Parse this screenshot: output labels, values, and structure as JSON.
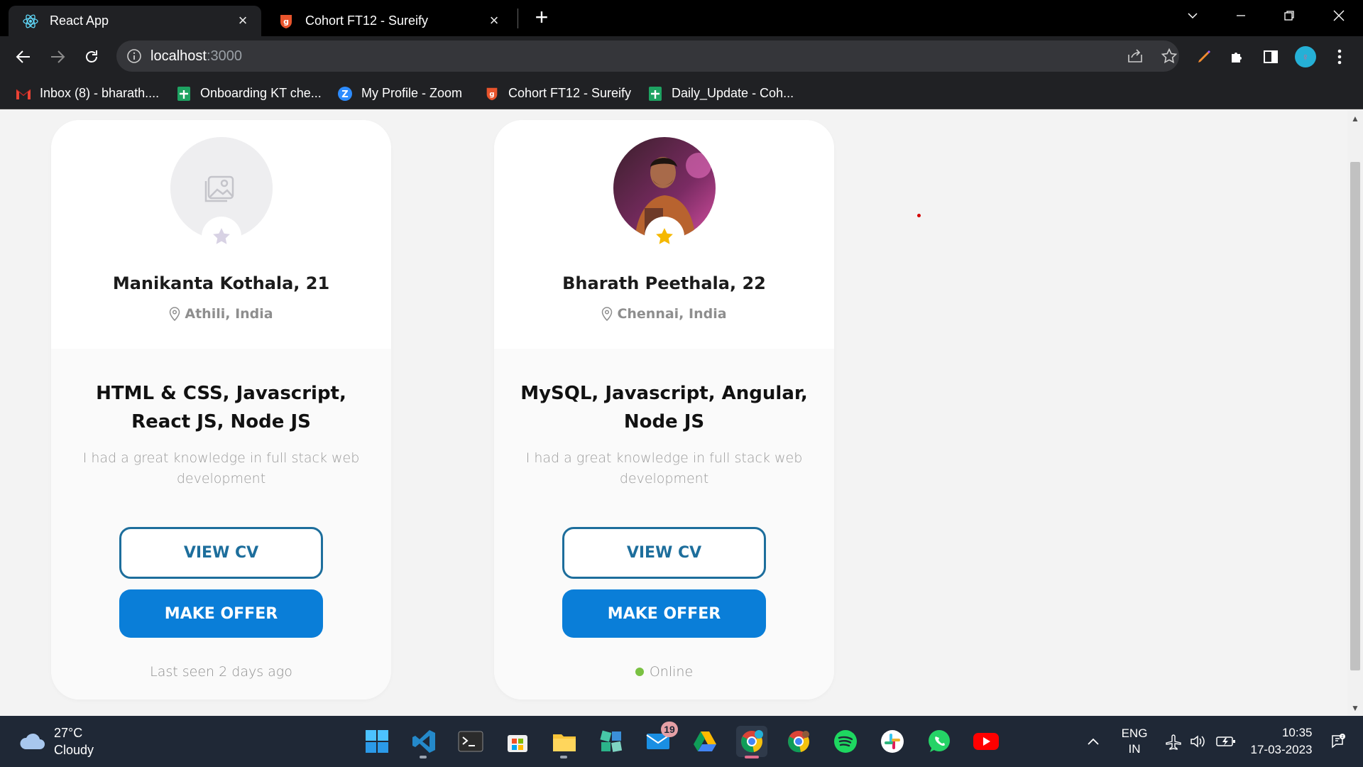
{
  "browser": {
    "tabs": [
      {
        "title": "React App",
        "icon": "react-icon",
        "active": true
      },
      {
        "title": "Cohort FT12 - Sureify",
        "icon": "sureify-icon",
        "active": false
      }
    ],
    "new_tab_label": "+",
    "url_host": "localhost",
    "url_port": ":3000",
    "bookmarks": [
      {
        "label": "Inbox (8) - bharath....",
        "icon": "gmail-icon"
      },
      {
        "label": "Onboarding KT che...",
        "icon": "google-sheets-icon"
      },
      {
        "label": "My Profile - Zoom",
        "icon": "zoom-icon"
      },
      {
        "label": "Cohort FT12 - Sureify",
        "icon": "sureify-icon"
      },
      {
        "label": "Daily_Update - Coh...",
        "icon": "google-sheets-icon"
      }
    ]
  },
  "cards": [
    {
      "name": "Manikanta Kothala, 21",
      "location": "Athili, India",
      "skills": "HTML & CSS, Javascript, React JS, Node JS",
      "bio": "I had a great knowledge in full stack web development",
      "view_cv_label": "VIEW CV",
      "make_offer_label": "MAKE OFFER",
      "status": "Last seen 2 days ago",
      "online": false,
      "starred": false
    },
    {
      "name": "Bharath Peethala, 22",
      "location": "Chennai, India",
      "skills": "MySQL, Javascript, Angular, Node JS",
      "bio": "I had a great knowledge in full stack web development",
      "view_cv_label": "VIEW CV",
      "make_offer_label": "MAKE OFFER",
      "status": "Online",
      "online": true,
      "starred": true
    }
  ],
  "colors": {
    "primary_blue": "#0a7ed8",
    "outline_blue": "#1d6e9c",
    "star_gold": "#f5b800",
    "online_green": "#7ac142"
  },
  "taskbar": {
    "weather_temp": "27°C",
    "weather_desc": "Cloudy",
    "mail_badge": "19",
    "lang_line1": "ENG",
    "lang_line2": "IN",
    "time": "10:35",
    "date": "17-03-2023",
    "apps": [
      "windows-start-icon",
      "vscode-icon",
      "terminal-icon",
      "microsoft-store-icon",
      "file-explorer-icon",
      "widgets-icon",
      "mail-icon",
      "google-drive-icon",
      "chrome-profile-icon",
      "chrome-icon",
      "spotify-icon",
      "slack-icon",
      "whatsapp-icon",
      "youtube-icon"
    ]
  }
}
